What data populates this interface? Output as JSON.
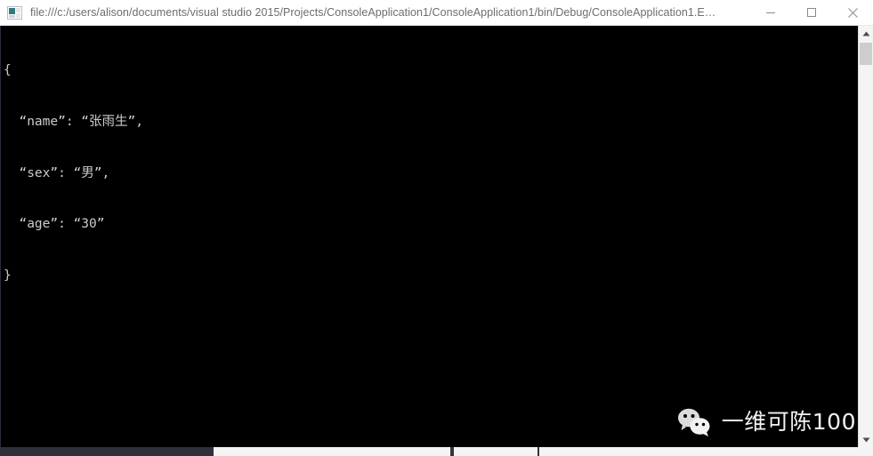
{
  "window": {
    "title": "file:///c:/users/alison/documents/visual studio 2015/Projects/ConsoleApplication1/ConsoleApplication1/bin/Debug/ConsoleApplication1.E…",
    "icon_name": "console-app-icon",
    "controls": {
      "minimize_label": "Minimize",
      "maximize_label": "Maximize",
      "close_label": "Close"
    }
  },
  "console": {
    "background_color": "#000000",
    "text_color": "#cccccc",
    "lines": [
      "{",
      "  “name”: “张雨生”,",
      "  “sex”: “男”,",
      "  “age”: “30”",
      "}"
    ]
  },
  "watermark": {
    "logo_name": "wechat-logo",
    "text": "一维可陈100"
  },
  "scrollbars": {
    "vertical": {
      "up_arrow": "▲",
      "down_arrow": "▼",
      "thumb_position": "top"
    },
    "horizontal": {
      "thumb_position": "left"
    }
  }
}
